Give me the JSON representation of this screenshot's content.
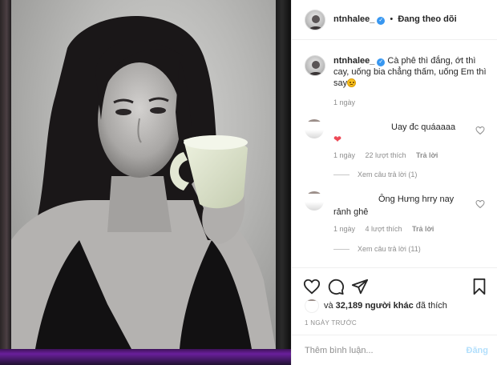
{
  "post": {
    "author": "ntnhalee_",
    "verified": true,
    "follow_state": "Đang theo dõi",
    "separator": "•"
  },
  "caption": {
    "author": "ntnhalee_",
    "text": "Cà phê thì đắng, ớt thì cay, uống bia chẳng thấm, uống Em thì say",
    "emoji": "weary-face-icon",
    "time": "1 ngày"
  },
  "comments": [
    {
      "text": "Uay đc quáaaaa",
      "reaction": "❤",
      "time": "1 ngày",
      "likes": "22 lượt thích",
      "reply_label": "Trả lời",
      "view_replies": "Xem câu trả lời (1)"
    },
    {
      "text_line1": "Ông Hưng hrry nay",
      "text_line2": "rảnh ghê",
      "time": "1 ngày",
      "likes": "4 lượt thích",
      "reply_label": "Trả lời",
      "view_replies": "Xem câu trả lời (11)"
    }
  ],
  "actions": {
    "like": "heart-icon",
    "comment": "comment-icon",
    "share": "share-icon",
    "save": "bookmark-icon"
  },
  "likes": {
    "prefix": "và",
    "count": "32,189 người khác",
    "suffix": "đã thích"
  },
  "timestamp": "1 NGÀY TRƯỚC",
  "comment_input": {
    "placeholder": "Thêm bình luận...",
    "post_label": "Đăng"
  },
  "colors": {
    "verified": "#3897f0",
    "heart": "#ed4956",
    "post_button": "#b2dffc",
    "muted_text": "#8e8e8e"
  }
}
